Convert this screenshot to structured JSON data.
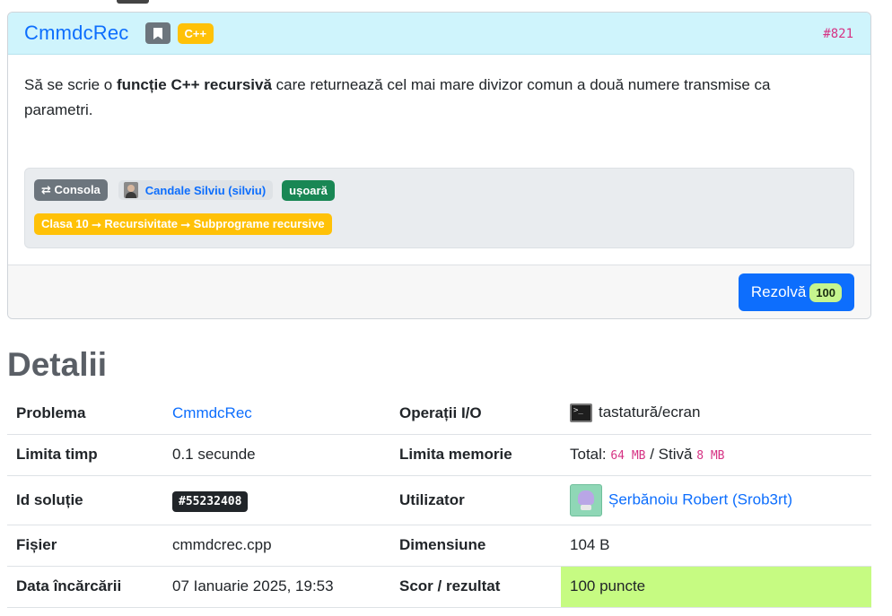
{
  "problem": {
    "title": "CmmdcRec",
    "language": "C++",
    "id": "#821",
    "statement_pre": "Să se scrie o ",
    "statement_bold": "funcție C++ recursivă",
    "statement_post": " care returnează cel mai mare divizor comun a două numere transmise ca parametri.",
    "tags": {
      "io": "⇄ Consola",
      "author": "Candale Silviu (silviu)",
      "difficulty": "ușoară",
      "category": "Clasa 10 ⭢ Recursivitate ⭢ Subprograme recursive"
    },
    "solve_button": "Rezolvă",
    "solve_score": "100"
  },
  "details": {
    "heading": "Detalii",
    "rows": {
      "problem_label": "Problema",
      "problem_value": "CmmdcRec",
      "io_label": "Operații I/O",
      "io_value": "tastatură/ecran",
      "time_label": "Limita timp",
      "time_value": "0.1 secunde",
      "memory_label": "Limita memorie",
      "memory_total_label": "Total: ",
      "memory_total": "64 MB",
      "memory_sep": " / Stivă ",
      "memory_stack": "8 MB",
      "solution_id_label": "Id soluție",
      "solution_id": "#55232408",
      "user_label": "Utilizator",
      "user_value": "Șerbănoiu Robert (Srob3rt)",
      "file_label": "Fișier",
      "file_value": "cmmdcrec.cpp",
      "size_label": "Dimensiune",
      "size_value": "104 B",
      "upload_label": "Data încărcării",
      "upload_value": "07 Ianuarie 2025, 19:53",
      "score_label": "Scor / rezultat",
      "score_value": "100 puncte"
    }
  },
  "colors": {
    "accent": "#0d6efd",
    "header_bg": "#cff4fc",
    "score_bg": "#c6fb82"
  }
}
